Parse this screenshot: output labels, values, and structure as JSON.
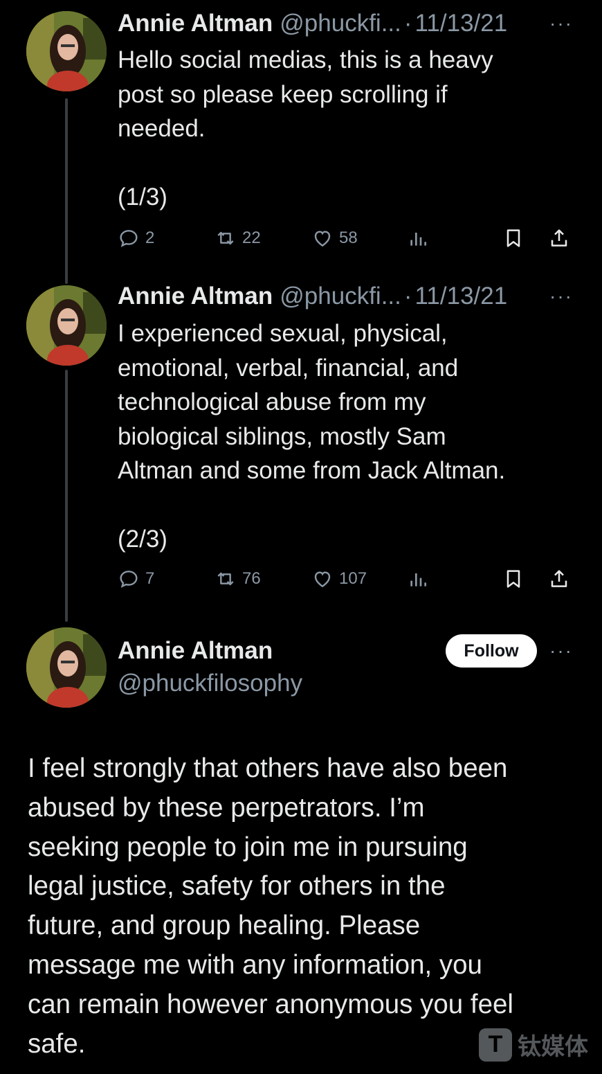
{
  "tweets": [
    {
      "author": "Annie Altman",
      "handle": "@phuckfi...",
      "separator": "·",
      "date": "11/13/21",
      "more": "···",
      "text": "Hello social medias, this is a heavy\npost so please keep scrolling if\nneeded.\n\n(1/3)",
      "replies": "2",
      "retweets": "22",
      "likes": "58"
    },
    {
      "author": "Annie Altman",
      "handle": "@phuckfi...",
      "separator": "·",
      "date": "11/13/21",
      "more": "···",
      "text": "I experienced sexual, physical,\nemotional, verbal, financial, and\ntechnological abuse from my\nbiological siblings, mostly Sam\nAltman and some from Jack Altman.\n\n(2/3)",
      "replies": "7",
      "retweets": "76",
      "likes": "107"
    }
  ],
  "main_tweet": {
    "author": "Annie Altman",
    "handle": "@phuckfilosophy",
    "follow_label": "Follow",
    "more": "···",
    "text": "I feel strongly that others have also been\nabused by these perpetrators. I’m\nseeking people to join me in pursuing\nlegal justice, safety for others in the\nfuture, and group healing. Please\nmessage me with any information, you\ncan remain however anonymous you feel\nsafe."
  },
  "watermark": {
    "logo_letter": "T",
    "text": "钛媒体"
  },
  "colors": {
    "background": "#000000",
    "text_primary": "#e7e9ea",
    "text_secondary": "#8b98a5",
    "thread_line": "#3a3d41",
    "follow_bg": "#ffffff"
  }
}
